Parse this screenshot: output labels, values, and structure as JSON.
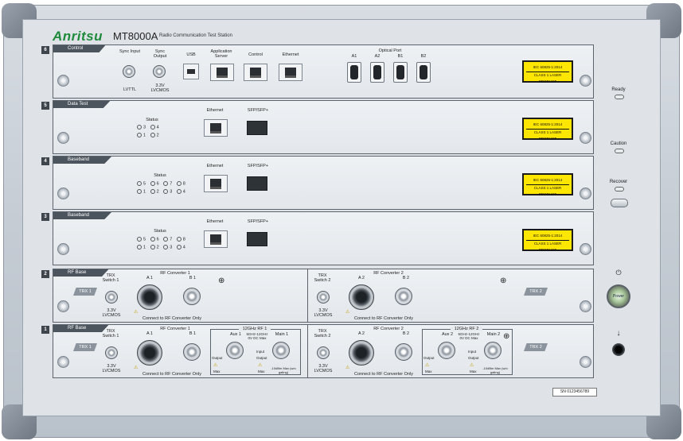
{
  "brand": "Anritsu",
  "model": "MT8000A",
  "subtitle": "Radio Communication Test Station",
  "slots": [
    {
      "number": "6",
      "name": "Control"
    },
    {
      "number": "5",
      "name": "Data Test"
    },
    {
      "number": "4",
      "name": "Baseband"
    },
    {
      "number": "3",
      "name": "Baseband"
    },
    {
      "number": "2",
      "name": "RF Base"
    },
    {
      "number": "1",
      "name": "RF Base"
    }
  ],
  "control": {
    "sync_input": "Sync Input",
    "sync_output": "Sync Output",
    "lvttl": "LVTTL",
    "sync_out_level": "3.3V LVCMOS",
    "usb": "USB",
    "app_server": "Application Server",
    "control": "Control",
    "ethernet": "Ethernet",
    "optical_port": "Optical Port",
    "optical": [
      "A1",
      "A2",
      "B1",
      "B2"
    ]
  },
  "laser": {
    "line1": "IEC 60825-1:2014",
    "line2": "CLASS 1 LASER PRODUCT"
  },
  "datatest": {
    "status": "Status",
    "ethernet": "Ethernet",
    "sfp": "SFP/SFP+",
    "leds": [
      "3",
      "4",
      "1",
      "2"
    ]
  },
  "baseband": {
    "status": "Status",
    "ethernet": "Ethernet",
    "sfp": "SFP/SFP+",
    "leds": [
      "5",
      "6",
      "7",
      "8",
      "1",
      "2",
      "3",
      "4"
    ]
  },
  "rf": {
    "trx1": "TRX 1",
    "trx2": "TRX 2",
    "trx_switch1": "TRX Switch 1",
    "trx_switch2": "TRX Switch 2",
    "level": "3.3V LVCMOS",
    "converter1": "RF Converter 1",
    "converter2": "RF Converter 2",
    "a1": "A 1",
    "b1": "B 1",
    "a2": "A 2",
    "b2": "B 2",
    "connect_only": "Connect to RF Converter Only",
    "rf1": "12GHz RF 1",
    "rf2": "12GHz RF 2",
    "aux1": "Aux 1",
    "aux2": "Aux 2",
    "main1": "Main 1",
    "main2": "Main 2",
    "freq_range": "5GHz-12GHz 0V DC Max",
    "output": "Output",
    "input": "Input",
    "max": "Max",
    "dbm": "-10dBm Max (w/o gating)"
  },
  "side": {
    "ready": "Ready",
    "caution": "Caution",
    "recover": "Recover",
    "power": "Power",
    "standby_symbol": "⏻",
    "arrow": "↓"
  },
  "serial": "SN 0123456789"
}
